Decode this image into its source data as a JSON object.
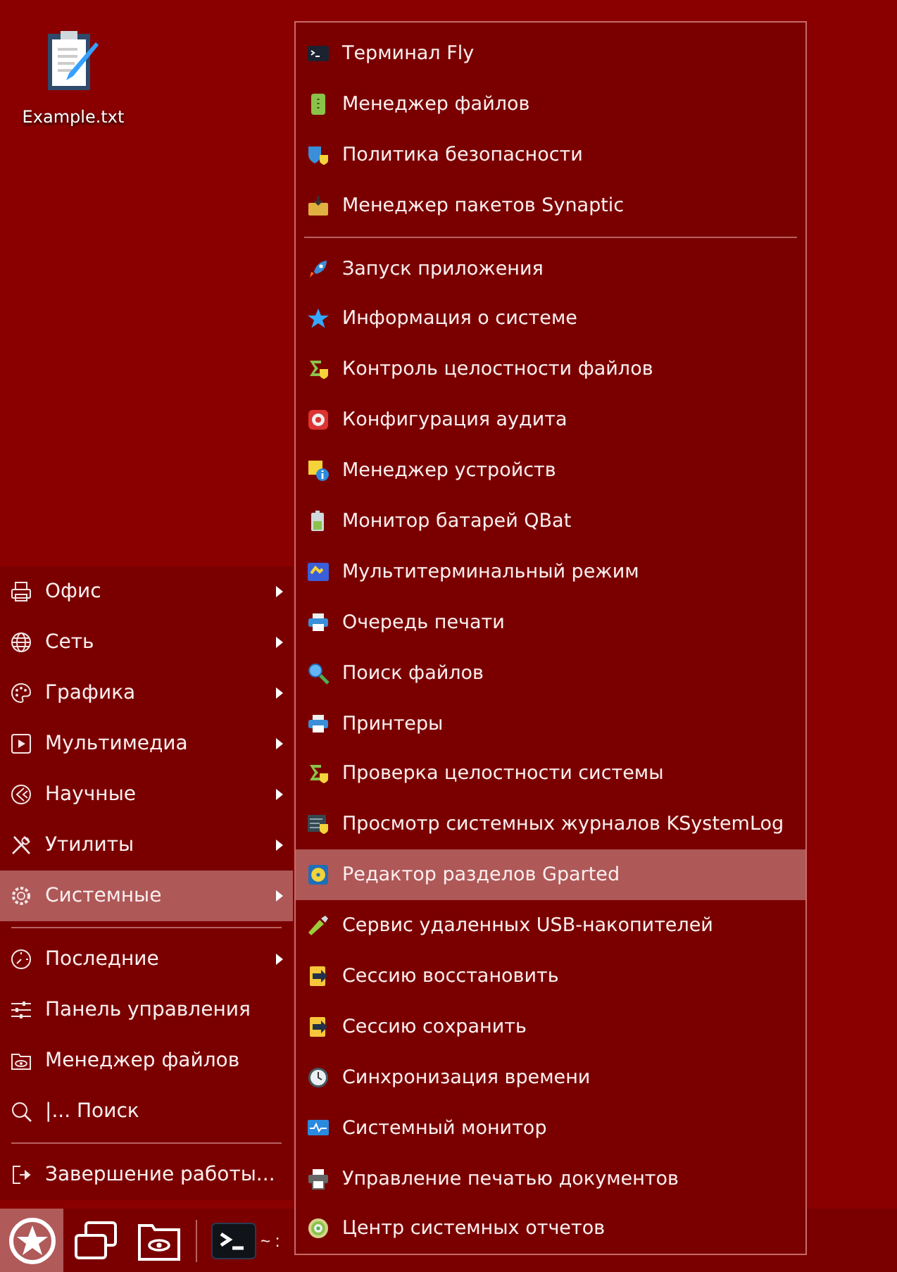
{
  "desktop_icons": [
    {
      "label": "Example.txt"
    }
  ],
  "main_menu": {
    "groups": [
      [
        {
          "label": "Офис",
          "submenu": true,
          "selected": false
        },
        {
          "label": "Сеть",
          "submenu": true,
          "selected": false
        },
        {
          "label": "Графика",
          "submenu": true,
          "selected": false
        },
        {
          "label": "Мультимедиа",
          "submenu": true,
          "selected": false
        },
        {
          "label": "Научные",
          "submenu": true,
          "selected": false
        },
        {
          "label": "Утилиты",
          "submenu": true,
          "selected": false
        },
        {
          "label": "Системные",
          "submenu": true,
          "selected": true
        }
      ],
      [
        {
          "label": "Последние",
          "submenu": true,
          "selected": false
        },
        {
          "label": "Панель управления",
          "submenu": false,
          "selected": false
        },
        {
          "label": "Менеджер файлов",
          "submenu": false,
          "selected": false
        },
        {
          "label": "|... Поиск",
          "submenu": false,
          "selected": false
        }
      ],
      [
        {
          "label": "Завершение работы...",
          "submenu": false,
          "selected": false
        }
      ]
    ]
  },
  "submenu": {
    "groups": [
      [
        {
          "label": "Терминал Fly",
          "selected": false
        },
        {
          "label": "Менеджер файлов",
          "selected": false
        },
        {
          "label": "Политика безопасности",
          "selected": false
        },
        {
          "label": "Менеджер пакетов Synaptic",
          "selected": false
        }
      ],
      [
        {
          "label": "Запуск приложения",
          "selected": false
        },
        {
          "label": "Информация о системе",
          "selected": false
        },
        {
          "label": "Контроль целостности файлов",
          "selected": false
        },
        {
          "label": "Конфигурация аудита",
          "selected": false
        },
        {
          "label": "Менеджер устройств",
          "selected": false
        },
        {
          "label": "Монитор батарей QBat",
          "selected": false
        },
        {
          "label": "Мультитерминальный режим",
          "selected": false
        },
        {
          "label": "Очередь печати",
          "selected": false
        },
        {
          "label": "Поиск файлов",
          "selected": false
        },
        {
          "label": "Принтеры",
          "selected": false
        },
        {
          "label": "Проверка целостности системы",
          "selected": false
        },
        {
          "label": "Просмотр системных журналов KSystemLog",
          "selected": false
        },
        {
          "label": "Редактор разделов Gparted",
          "selected": true
        },
        {
          "label": "Сервис удаленных USB-накопителей",
          "selected": false
        },
        {
          "label": "Сессию восстановить",
          "selected": false
        },
        {
          "label": "Сессию сохранить",
          "selected": false
        },
        {
          "label": "Синхронизация времени",
          "selected": false
        },
        {
          "label": "Системный монитор",
          "selected": false
        },
        {
          "label": "Управление печатью документов",
          "selected": false
        },
        {
          "label": "Центр системных отчетов",
          "selected": false
        }
      ]
    ]
  },
  "taskbar": {
    "start_button": {
      "selected": true
    },
    "terminal_label": "~ :"
  }
}
